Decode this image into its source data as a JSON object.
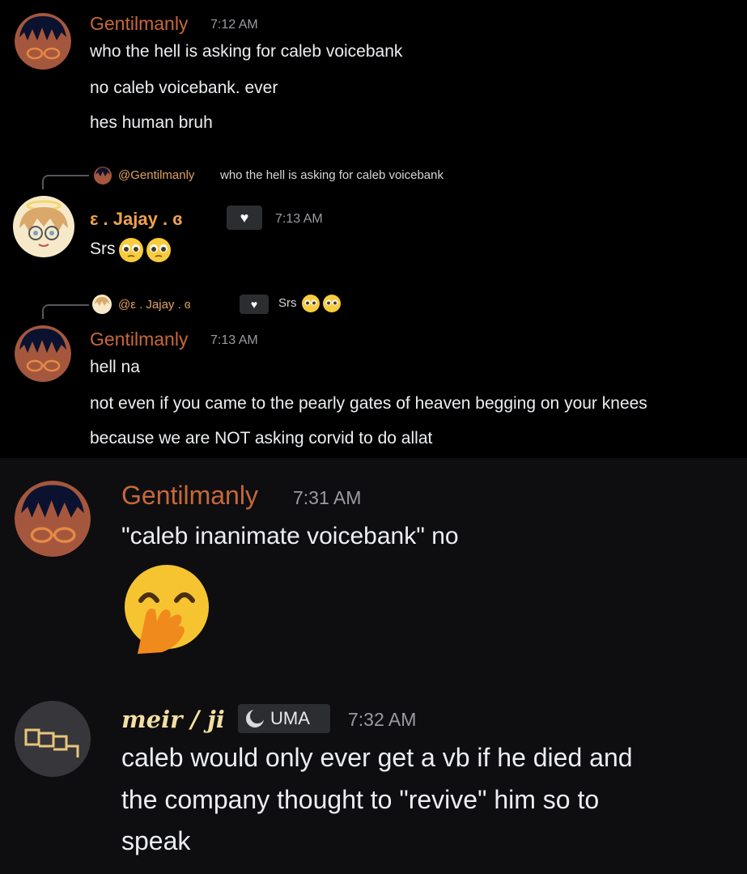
{
  "messages": [
    {
      "author": "Gentilmanly",
      "timestamp": "7:12 AM",
      "lines": [
        "who the hell is asking for caleb voicebank",
        "no caleb voicebank. ever",
        "hes human bruh"
      ]
    },
    {
      "reply_to": {
        "mention": "@Gentilmanly",
        "text": "who the hell is asking for caleb voicebank"
      },
      "author": "ε . Jajay . ɞ",
      "timestamp": "7:13 AM",
      "lines": [
        "Srs"
      ],
      "emoji": [
        "pleading-face-emoji",
        "pleading-face-emoji"
      ]
    },
    {
      "reply_to": {
        "mention": "@ε . Jajay . ɞ",
        "text": "Srs"
      },
      "author": "Gentilmanly",
      "timestamp": "7:13 AM",
      "lines": [
        "hell na",
        "not even if you came to the pearly gates of heaven begging on your knees",
        "because we are NOT asking corvid to do allat"
      ]
    },
    {
      "author": "Gentilmanly",
      "timestamp": "7:31 AM",
      "lines": [
        "\"caleb inanimate voicebank\" no"
      ],
      "emoji": [
        "face-with-hand-over-mouth-emoji"
      ]
    },
    {
      "author": "meir / ji",
      "tag": "UMA",
      "timestamp": "7:32 AM",
      "lines": [
        "caleb would only ever get a vb if he died and",
        "the company thought to \"revive\" him so to",
        "speak"
      ]
    }
  ],
  "colors": {
    "gentilmanly": "#c7683b",
    "jajay": "#f0a24a",
    "meir": "#f3dfa0",
    "timestamp": "#9a9ba1",
    "background_top": "#000000",
    "background_bottom": "#0e0e11"
  }
}
